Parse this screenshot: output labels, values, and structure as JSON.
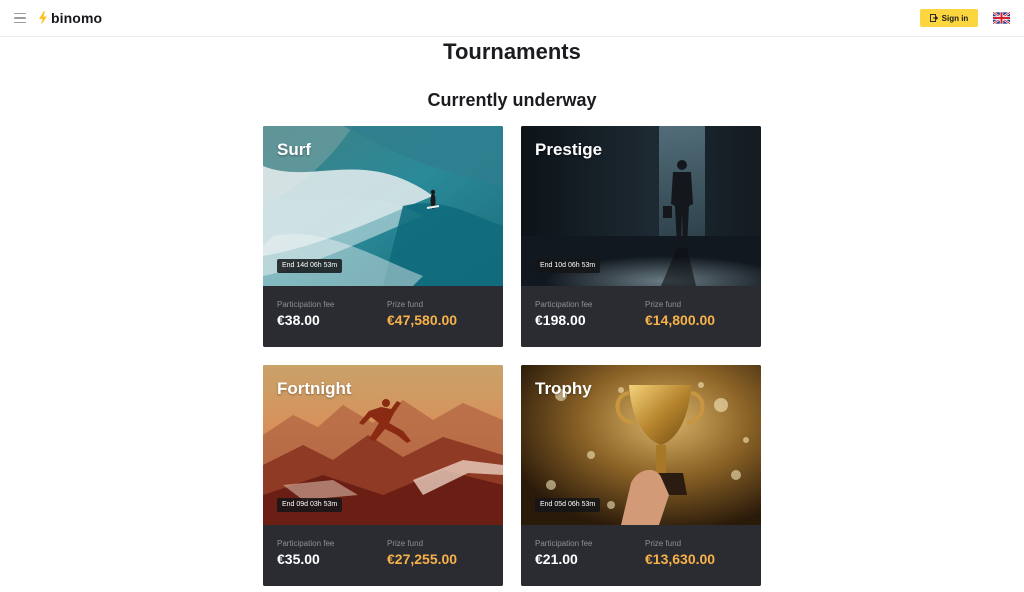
{
  "header": {
    "logo_text": "binomo",
    "signin_label": "Sign in",
    "language": "en-gb"
  },
  "page": {
    "title": "Tournaments",
    "section_title": "Currently underway"
  },
  "colors": {
    "accent": "#fcd53f",
    "prize": "#f7b24a",
    "card_bg": "#2b2c31"
  },
  "tournaments": [
    {
      "name": "Surf",
      "timer": "End 14d 06h 53m",
      "fee_label": "Participation fee",
      "fee": "€38.00",
      "prize_label": "Prize fund",
      "prize": "€47,580.00"
    },
    {
      "name": "Prestige",
      "timer": "End 10d 06h 53m",
      "fee_label": "Participation fee",
      "fee": "€198.00",
      "prize_label": "Prize fund",
      "prize": "€14,800.00"
    },
    {
      "name": "Fortnight",
      "timer": "End 09d 03h 53m",
      "fee_label": "Participation fee",
      "fee": "€35.00",
      "prize_label": "Prize fund",
      "prize": "€27,255.00"
    },
    {
      "name": "Trophy",
      "timer": "End 05d 06h 53m",
      "fee_label": "Participation fee",
      "fee": "€21.00",
      "prize_label": "Prize fund",
      "prize": "€13,630.00"
    }
  ]
}
